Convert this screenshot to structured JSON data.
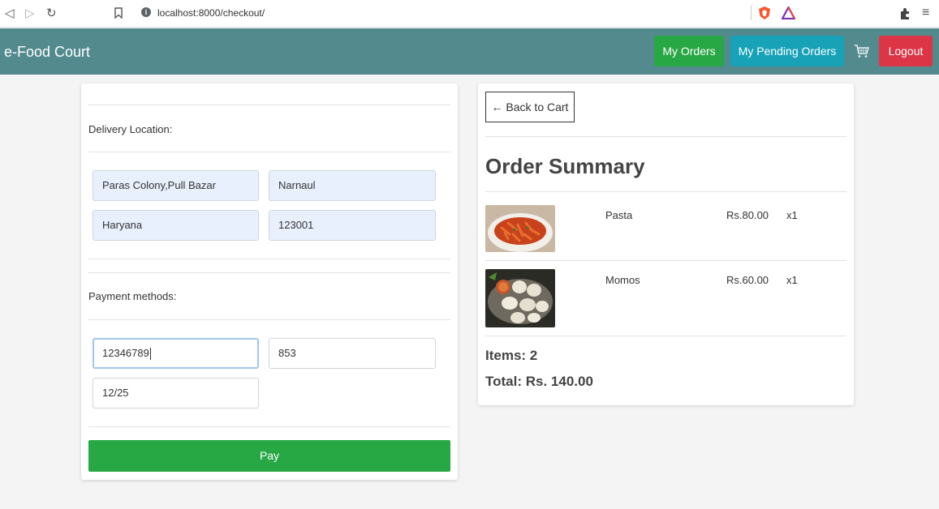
{
  "browser": {
    "url": "localhost:8000/checkout/"
  },
  "navbar": {
    "brand": "e-Food Court",
    "my_orders": "My Orders",
    "my_pending_orders": "My Pending Orders",
    "logout": "Logout",
    "colors": {
      "bar": "#538a8e",
      "orders": "#28a745",
      "pending": "#17a2b8",
      "logout": "#dc3545"
    }
  },
  "checkout": {
    "delivery_label": "Delivery Location:",
    "address": "Paras Colony,Pull Bazar",
    "city": "Narnaul",
    "state": "Haryana",
    "zip": "123001",
    "payment_label": "Payment methods:",
    "card_number": "12346789",
    "cvv": "853",
    "expiry": "12/25",
    "pay_label": "Pay"
  },
  "summary": {
    "back_label": "← Back to Cart",
    "title": "Order Summary",
    "items": [
      {
        "name": "Pasta",
        "price": "Rs.80.00",
        "qty": "x1"
      },
      {
        "name": "Momos",
        "price": "Rs.60.00",
        "qty": "x1"
      }
    ],
    "items_count": "Items: 2",
    "total": "Total: Rs. 140.00"
  }
}
